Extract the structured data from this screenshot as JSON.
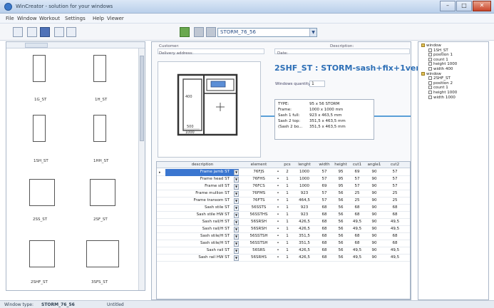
{
  "window": {
    "title": "WinCreator - solution for your windows",
    "controls": [
      "–",
      "□",
      "✕"
    ]
  },
  "menu": [
    "File",
    "Window",
    "Workout",
    "Settings",
    "Help",
    "Viewer"
  ],
  "toolbar": {
    "selected_window": "STORM_76_56"
  },
  "left_panel": {
    "thumbnails": [
      {
        "label": "1G_ST"
      },
      {
        "label": "1H_ST"
      },
      {
        "label": "1SH_ST"
      },
      {
        "label": "1HH_ST"
      },
      {
        "label": "2SS_ST"
      },
      {
        "label": "2SF_ST"
      },
      {
        "label": "2SHF_ST"
      },
      {
        "label": "3SFS_ST"
      }
    ]
  },
  "form": {
    "customer_label": "Customer:",
    "description_label": "Description:",
    "delivery_label": "Delivery address:",
    "date_label": "Date:"
  },
  "detail": {
    "title": "2SHF_ST : STORM-sash+fix+1vent",
    "quantity_label": "Windows quantity:",
    "quantity": "1",
    "dims": {
      "height": "400",
      "width": "1000",
      "small": "500"
    },
    "info": [
      {
        "key": "TYPE:",
        "value": "95 x 56 STORM"
      },
      {
        "key": "Frame:",
        "value": "1000 x 1000 mm"
      },
      {
        "key": "Sash 1 full:",
        "value": "923 x 463,5 mm"
      },
      {
        "key": "Sash 2 top:",
        "value": "351,5 x 463,5 mm"
      },
      {
        "key": "(Sash 2 bo...",
        "value": "351,5 x 463,5 mm"
      }
    ]
  },
  "grid": {
    "headers": [
      "description",
      "element",
      "pcs",
      "lenght",
      "width",
      "height",
      "cut1",
      "angle1",
      "cut2"
    ],
    "rows": [
      [
        "Frame jamb ST",
        "76FJS",
        "2",
        "1000",
        "57",
        "95",
        "69",
        "90",
        "57"
      ],
      [
        "Frame head ST",
        "76FHS",
        "1",
        "1000",
        "57",
        "95",
        "57",
        "90",
        "57"
      ],
      [
        "Frame sill ST",
        "76FCS",
        "1",
        "1000",
        "69",
        "95",
        "57",
        "90",
        "57"
      ],
      [
        "Frame mullion ST",
        "76FMS",
        "1",
        "923",
        "57",
        "56",
        "25",
        "90",
        "25"
      ],
      [
        "Frame transom ST",
        "76FTS",
        "1",
        "464,5",
        "57",
        "56",
        "25",
        "90",
        "25"
      ],
      [
        "Sash stile ST",
        "56SSTS",
        "1",
        "923",
        "68",
        "56",
        "68",
        "90",
        "68"
      ],
      [
        "Sash stile HW ST",
        "56SSTHS",
        "1",
        "923",
        "68",
        "56",
        "68",
        "90",
        "68"
      ],
      [
        "Sash rail/H ST",
        "56SRSH",
        "1",
        "426,5",
        "68",
        "56",
        "49,5",
        "90",
        "49,5"
      ],
      [
        "Sash rail/H ST",
        "56SRSH",
        "1",
        "426,5",
        "68",
        "56",
        "49,5",
        "90",
        "49,5"
      ],
      [
        "Sash stile/H ST",
        "56SSTSH",
        "1",
        "351,5",
        "68",
        "56",
        "68",
        "90",
        "68"
      ],
      [
        "Sash stile/H ST",
        "56SSTSH",
        "1",
        "351,5",
        "68",
        "56",
        "68",
        "90",
        "68"
      ],
      [
        "Sash rail ST",
        "56SRS",
        "1",
        "426,5",
        "68",
        "56",
        "49,5",
        "90",
        "49,5"
      ],
      [
        "Sash rail HW ST",
        "56SRHS",
        "1",
        "426,5",
        "68",
        "56",
        "49,5",
        "90",
        "49,5"
      ]
    ]
  },
  "tree": {
    "items": [
      {
        "label": "window",
        "level": 0,
        "folder": true
      },
      {
        "label": "1SH_ST",
        "level": 1,
        "folder": false
      },
      {
        "label": "position 1",
        "level": 1,
        "folder": false
      },
      {
        "label": "count 1",
        "level": 1,
        "folder": false
      },
      {
        "label": "height 1000",
        "level": 1,
        "folder": false
      },
      {
        "label": "width 400",
        "level": 1,
        "folder": false
      },
      {
        "label": "window",
        "level": 0,
        "folder": true
      },
      {
        "label": "2SHF_ST",
        "level": 1,
        "folder": false
      },
      {
        "label": "position 2",
        "level": 1,
        "folder": false
      },
      {
        "label": "count 1",
        "level": 1,
        "folder": false
      },
      {
        "label": "height 1000",
        "level": 1,
        "folder": false
      },
      {
        "label": "width 1000",
        "level": 1,
        "folder": false
      }
    ]
  },
  "status": {
    "window_label": "Window type:",
    "window_value": "STORM_76_56",
    "state": "Untitled"
  }
}
